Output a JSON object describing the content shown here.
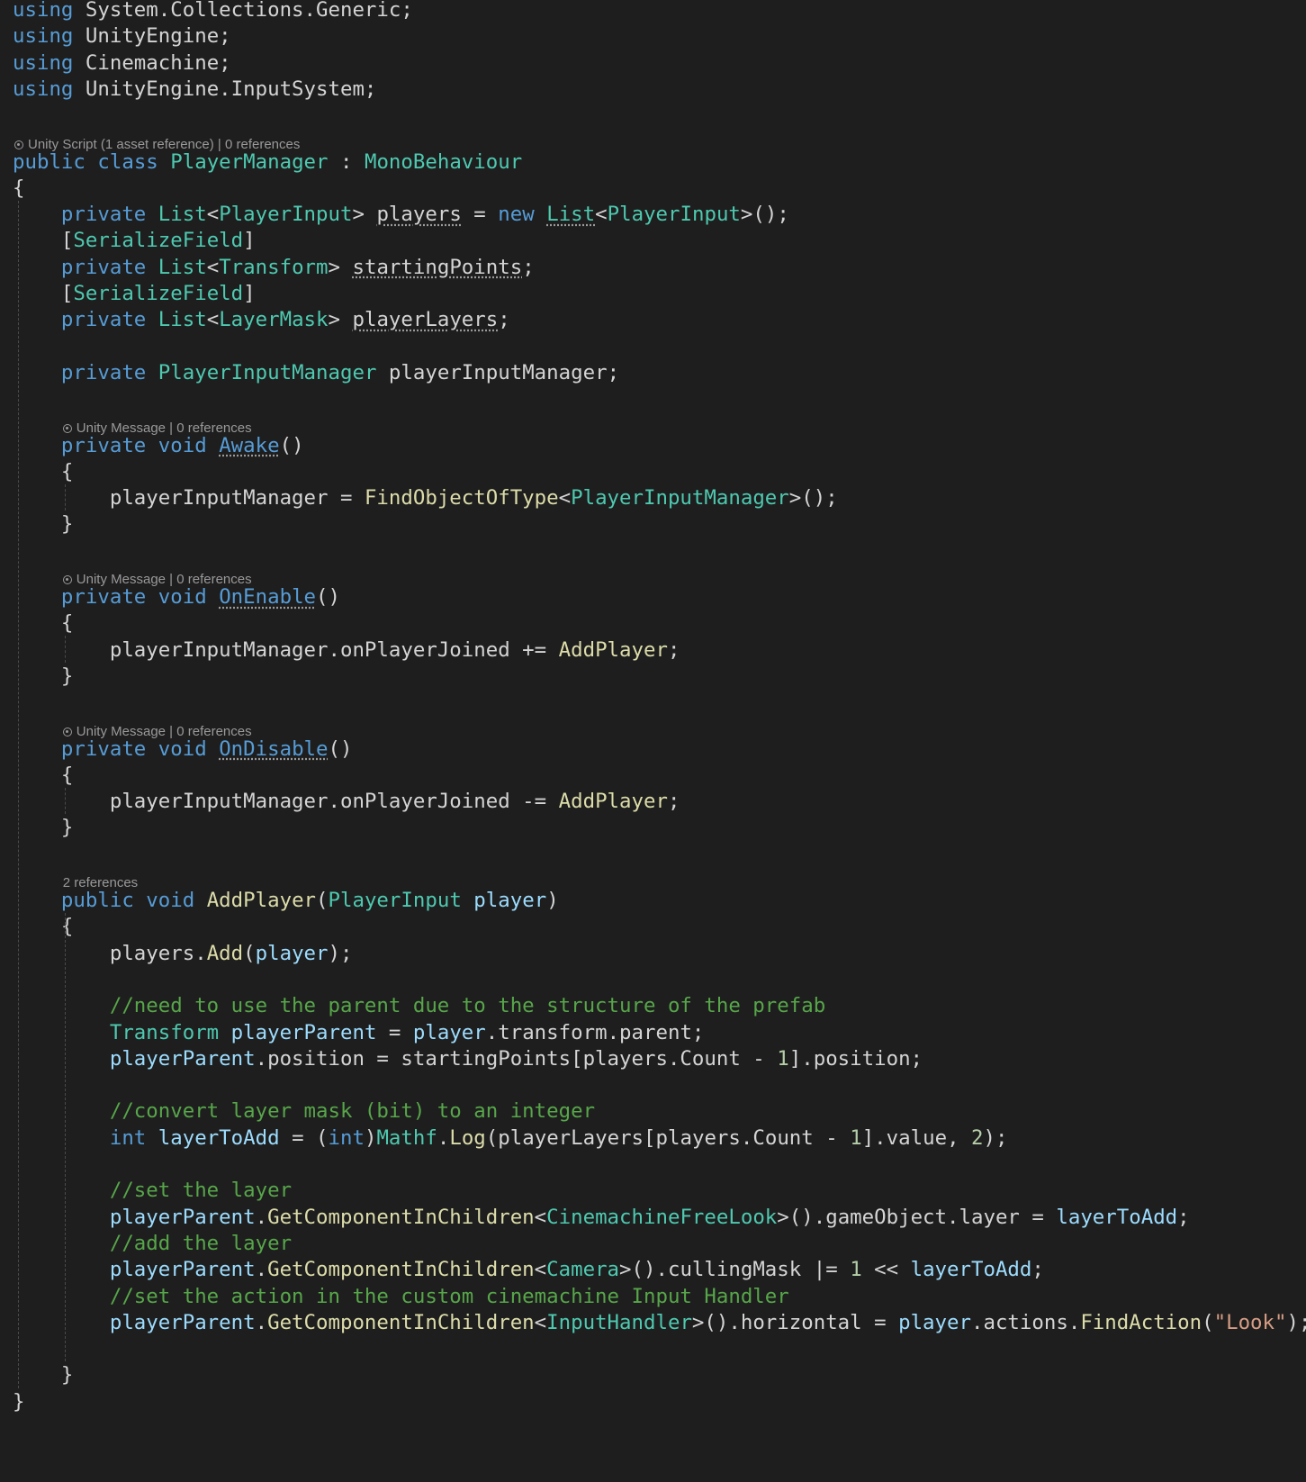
{
  "colors": {
    "background": "#1e1e1e",
    "keyword": "#569cd6",
    "type": "#4ec9b0",
    "method": "#dcdcaa",
    "variable": "#9cdcfe",
    "comment": "#57a64a",
    "string": "#d69d85",
    "number": "#b5cea8",
    "plain": "#d4d4d4",
    "codelens": "#999999"
  },
  "editor": {
    "language": "C#",
    "lines": [
      {
        "tokens": [
          {
            "t": "using",
            "c": "keyword"
          },
          {
            "t": " System.Collections.Generic;",
            "c": "plain"
          }
        ]
      },
      {
        "tokens": [
          {
            "t": "using",
            "c": "keyword"
          },
          {
            "t": " UnityEngine;",
            "c": "plain"
          }
        ]
      },
      {
        "tokens": [
          {
            "t": "using",
            "c": "keyword"
          },
          {
            "t": " Cinemachine;",
            "c": "plain"
          }
        ]
      },
      {
        "tokens": [
          {
            "t": "using",
            "c": "keyword"
          },
          {
            "t": " UnityEngine.InputSystem;",
            "c": "plain"
          }
        ]
      },
      {
        "tokens": []
      },
      {
        "lens": "Unity Script (1 asset reference) | 0 references",
        "icon": true,
        "indent": 0
      },
      {
        "tokens": [
          {
            "t": "public",
            "c": "keyword"
          },
          {
            "t": " ",
            "c": "plain"
          },
          {
            "t": "class",
            "c": "keyword"
          },
          {
            "t": " ",
            "c": "plain"
          },
          {
            "t": "PlayerManager",
            "c": "type"
          },
          {
            "t": " : ",
            "c": "plain"
          },
          {
            "t": "MonoBehaviour",
            "c": "type"
          }
        ]
      },
      {
        "tokens": [
          {
            "t": "{",
            "c": "plain"
          }
        ]
      },
      {
        "tokens": [
          {
            "t": "    ",
            "c": "plain"
          },
          {
            "t": "private",
            "c": "keyword"
          },
          {
            "t": " ",
            "c": "plain"
          },
          {
            "t": "List",
            "c": "type"
          },
          {
            "t": "<",
            "c": "plain"
          },
          {
            "t": "PlayerInput",
            "c": "type"
          },
          {
            "t": "> ",
            "c": "plain"
          },
          {
            "t": "players",
            "c": "plain",
            "u": true
          },
          {
            "t": " = ",
            "c": "plain"
          },
          {
            "t": "new",
            "c": "keyword"
          },
          {
            "t": " ",
            "c": "plain"
          },
          {
            "t": "List",
            "c": "type",
            "u": true
          },
          {
            "t": "<",
            "c": "plain"
          },
          {
            "t": "PlayerInput",
            "c": "type"
          },
          {
            "t": ">();",
            "c": "plain"
          }
        ]
      },
      {
        "tokens": [
          {
            "t": "    [",
            "c": "plain"
          },
          {
            "t": "SerializeField",
            "c": "type"
          },
          {
            "t": "]",
            "c": "plain"
          }
        ]
      },
      {
        "tokens": [
          {
            "t": "    ",
            "c": "plain"
          },
          {
            "t": "private",
            "c": "keyword"
          },
          {
            "t": " ",
            "c": "plain"
          },
          {
            "t": "List",
            "c": "type"
          },
          {
            "t": "<",
            "c": "plain"
          },
          {
            "t": "Transform",
            "c": "type"
          },
          {
            "t": "> ",
            "c": "plain"
          },
          {
            "t": "startingPoints",
            "c": "plain",
            "u": true
          },
          {
            "t": ";",
            "c": "plain"
          }
        ]
      },
      {
        "tokens": [
          {
            "t": "    [",
            "c": "plain"
          },
          {
            "t": "SerializeField",
            "c": "type"
          },
          {
            "t": "]",
            "c": "plain"
          }
        ]
      },
      {
        "tokens": [
          {
            "t": "    ",
            "c": "plain"
          },
          {
            "t": "private",
            "c": "keyword"
          },
          {
            "t": " ",
            "c": "plain"
          },
          {
            "t": "List",
            "c": "type"
          },
          {
            "t": "<",
            "c": "plain"
          },
          {
            "t": "LayerMask",
            "c": "type"
          },
          {
            "t": "> ",
            "c": "plain"
          },
          {
            "t": "playerLayers",
            "c": "plain",
            "u": true
          },
          {
            "t": ";",
            "c": "plain"
          }
        ]
      },
      {
        "tokens": []
      },
      {
        "tokens": [
          {
            "t": "    ",
            "c": "plain"
          },
          {
            "t": "private",
            "c": "keyword"
          },
          {
            "t": " ",
            "c": "plain"
          },
          {
            "t": "PlayerInputManager",
            "c": "type"
          },
          {
            "t": " playerInputManager;",
            "c": "plain"
          }
        ]
      },
      {
        "tokens": []
      },
      {
        "lens": "Unity Message | 0 references",
        "icon": true,
        "indent": 4
      },
      {
        "tokens": [
          {
            "t": "    ",
            "c": "plain"
          },
          {
            "t": "private",
            "c": "keyword"
          },
          {
            "t": " ",
            "c": "plain"
          },
          {
            "t": "void",
            "c": "keyword"
          },
          {
            "t": " ",
            "c": "plain"
          },
          {
            "t": "Awake",
            "c": "keyword",
            "u": true
          },
          {
            "t": "()",
            "c": "plain"
          }
        ]
      },
      {
        "tokens": [
          {
            "t": "    {",
            "c": "plain"
          }
        ]
      },
      {
        "tokens": [
          {
            "t": "        playerInputManager = ",
            "c": "plain"
          },
          {
            "t": "FindObjectOfType",
            "c": "method"
          },
          {
            "t": "<",
            "c": "plain"
          },
          {
            "t": "PlayerInputManager",
            "c": "type"
          },
          {
            "t": ">();",
            "c": "plain"
          }
        ]
      },
      {
        "tokens": [
          {
            "t": "    }",
            "c": "plain"
          }
        ]
      },
      {
        "tokens": []
      },
      {
        "lens": "Unity Message | 0 references",
        "icon": true,
        "indent": 4
      },
      {
        "tokens": [
          {
            "t": "    ",
            "c": "plain"
          },
          {
            "t": "private",
            "c": "keyword"
          },
          {
            "t": " ",
            "c": "plain"
          },
          {
            "t": "void",
            "c": "keyword"
          },
          {
            "t": " ",
            "c": "plain"
          },
          {
            "t": "OnEnable",
            "c": "keyword",
            "u": true
          },
          {
            "t": "()",
            "c": "plain"
          }
        ]
      },
      {
        "tokens": [
          {
            "t": "    {",
            "c": "plain"
          }
        ]
      },
      {
        "tokens": [
          {
            "t": "        playerInputManager.onPlayerJoined += ",
            "c": "plain"
          },
          {
            "t": "AddPlayer",
            "c": "method"
          },
          {
            "t": ";",
            "c": "plain"
          }
        ]
      },
      {
        "tokens": [
          {
            "t": "    }",
            "c": "plain"
          }
        ]
      },
      {
        "tokens": []
      },
      {
        "lens": "Unity Message | 0 references",
        "icon": true,
        "indent": 4
      },
      {
        "tokens": [
          {
            "t": "    ",
            "c": "plain"
          },
          {
            "t": "private",
            "c": "keyword"
          },
          {
            "t": " ",
            "c": "plain"
          },
          {
            "t": "void",
            "c": "keyword"
          },
          {
            "t": " ",
            "c": "plain"
          },
          {
            "t": "OnDisable",
            "c": "keyword",
            "u": true
          },
          {
            "t": "()",
            "c": "plain"
          }
        ]
      },
      {
        "tokens": [
          {
            "t": "    {",
            "c": "plain"
          }
        ]
      },
      {
        "tokens": [
          {
            "t": "        playerInputManager.onPlayerJoined -= ",
            "c": "plain"
          },
          {
            "t": "AddPlayer",
            "c": "method"
          },
          {
            "t": ";",
            "c": "plain"
          }
        ]
      },
      {
        "tokens": [
          {
            "t": "    }",
            "c": "plain"
          }
        ]
      },
      {
        "tokens": []
      },
      {
        "lens": "2 references",
        "icon": false,
        "indent": 4
      },
      {
        "tokens": [
          {
            "t": "    ",
            "c": "plain"
          },
          {
            "t": "public",
            "c": "keyword"
          },
          {
            "t": " ",
            "c": "plain"
          },
          {
            "t": "void",
            "c": "keyword"
          },
          {
            "t": " ",
            "c": "plain"
          },
          {
            "t": "AddPlayer",
            "c": "method"
          },
          {
            "t": "(",
            "c": "plain"
          },
          {
            "t": "PlayerInput",
            "c": "type"
          },
          {
            "t": " ",
            "c": "plain"
          },
          {
            "t": "player",
            "c": "variable"
          },
          {
            "t": ")",
            "c": "plain"
          }
        ]
      },
      {
        "tokens": [
          {
            "t": "    {",
            "c": "plain"
          }
        ]
      },
      {
        "tokens": [
          {
            "t": "        players.",
            "c": "plain"
          },
          {
            "t": "Add",
            "c": "method"
          },
          {
            "t": "(",
            "c": "plain"
          },
          {
            "t": "player",
            "c": "variable"
          },
          {
            "t": ");",
            "c": "plain"
          }
        ]
      },
      {
        "tokens": []
      },
      {
        "tokens": [
          {
            "t": "        ",
            "c": "plain"
          },
          {
            "t": "//need to use the parent due to the structure of the prefab",
            "c": "comment"
          }
        ]
      },
      {
        "tokens": [
          {
            "t": "        ",
            "c": "plain"
          },
          {
            "t": "Transform",
            "c": "type"
          },
          {
            "t": " ",
            "c": "plain"
          },
          {
            "t": "playerParent",
            "c": "variable"
          },
          {
            "t": " = ",
            "c": "plain"
          },
          {
            "t": "player",
            "c": "variable"
          },
          {
            "t": ".transform.parent;",
            "c": "plain"
          }
        ]
      },
      {
        "tokens": [
          {
            "t": "        ",
            "c": "plain"
          },
          {
            "t": "playerParent",
            "c": "variable"
          },
          {
            "t": ".position = startingPoints[players.Count - ",
            "c": "plain"
          },
          {
            "t": "1",
            "c": "number"
          },
          {
            "t": "].position;",
            "c": "plain"
          }
        ]
      },
      {
        "tokens": []
      },
      {
        "tokens": [
          {
            "t": "        ",
            "c": "plain"
          },
          {
            "t": "//convert layer mask (bit) to an integer",
            "c": "comment"
          }
        ]
      },
      {
        "tokens": [
          {
            "t": "        ",
            "c": "plain"
          },
          {
            "t": "int",
            "c": "keyword"
          },
          {
            "t": " ",
            "c": "plain"
          },
          {
            "t": "layerToAdd",
            "c": "variable"
          },
          {
            "t": " = (",
            "c": "plain"
          },
          {
            "t": "int",
            "c": "keyword"
          },
          {
            "t": ")",
            "c": "plain"
          },
          {
            "t": "Mathf",
            "c": "type"
          },
          {
            "t": ".",
            "c": "plain"
          },
          {
            "t": "Log",
            "c": "method"
          },
          {
            "t": "(playerLayers[players.Count - ",
            "c": "plain"
          },
          {
            "t": "1",
            "c": "number"
          },
          {
            "t": "].value, ",
            "c": "plain"
          },
          {
            "t": "2",
            "c": "number"
          },
          {
            "t": ");",
            "c": "plain"
          }
        ]
      },
      {
        "tokens": []
      },
      {
        "tokens": [
          {
            "t": "        ",
            "c": "plain"
          },
          {
            "t": "//set the layer",
            "c": "comment"
          }
        ]
      },
      {
        "tokens": [
          {
            "t": "        ",
            "c": "plain"
          },
          {
            "t": "playerParent",
            "c": "variable"
          },
          {
            "t": ".",
            "c": "plain"
          },
          {
            "t": "GetComponentInChildren",
            "c": "method"
          },
          {
            "t": "<",
            "c": "plain"
          },
          {
            "t": "CinemachineFreeLook",
            "c": "type"
          },
          {
            "t": ">().gameObject.layer = ",
            "c": "plain"
          },
          {
            "t": "layerToAdd",
            "c": "variable"
          },
          {
            "t": ";",
            "c": "plain"
          }
        ]
      },
      {
        "tokens": [
          {
            "t": "        ",
            "c": "plain"
          },
          {
            "t": "//add the layer",
            "c": "comment"
          }
        ]
      },
      {
        "tokens": [
          {
            "t": "        ",
            "c": "plain"
          },
          {
            "t": "playerParent",
            "c": "variable"
          },
          {
            "t": ".",
            "c": "plain"
          },
          {
            "t": "GetComponentInChildren",
            "c": "method"
          },
          {
            "t": "<",
            "c": "plain"
          },
          {
            "t": "Camera",
            "c": "type"
          },
          {
            "t": ">().cullingMask |= ",
            "c": "plain"
          },
          {
            "t": "1",
            "c": "number"
          },
          {
            "t": " << ",
            "c": "plain"
          },
          {
            "t": "layerToAdd",
            "c": "variable"
          },
          {
            "t": ";",
            "c": "plain"
          }
        ]
      },
      {
        "tokens": [
          {
            "t": "        ",
            "c": "plain"
          },
          {
            "t": "//set the action in the custom cinemachine Input Handler",
            "c": "comment"
          }
        ]
      },
      {
        "tokens": [
          {
            "t": "        ",
            "c": "plain"
          },
          {
            "t": "playerParent",
            "c": "variable"
          },
          {
            "t": ".",
            "c": "plain"
          },
          {
            "t": "GetComponentInChildren",
            "c": "method"
          },
          {
            "t": "<",
            "c": "plain"
          },
          {
            "t": "InputHandler",
            "c": "type"
          },
          {
            "t": ">().horizontal = ",
            "c": "plain"
          },
          {
            "t": "player",
            "c": "variable"
          },
          {
            "t": ".actions.",
            "c": "plain"
          },
          {
            "t": "FindAction",
            "c": "method"
          },
          {
            "t": "(",
            "c": "plain"
          },
          {
            "t": "\"Look\"",
            "c": "string"
          },
          {
            "t": ");",
            "c": "plain"
          }
        ]
      },
      {
        "tokens": []
      },
      {
        "tokens": [
          {
            "t": "    }",
            "c": "plain"
          }
        ]
      },
      {
        "tokens": [
          {
            "t": "}",
            "c": "plain"
          }
        ]
      }
    ]
  }
}
